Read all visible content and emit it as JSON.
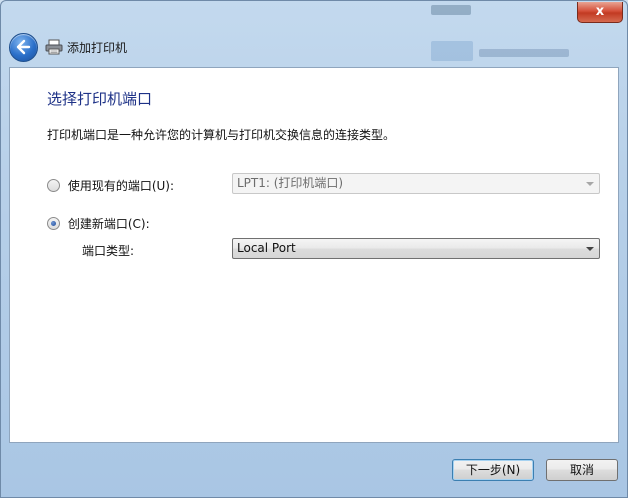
{
  "window": {
    "close_label": "x"
  },
  "nav": {
    "title": "添加打印机"
  },
  "page": {
    "title": "选择打印机端口",
    "description": "打印机端口是一种允许您的计算机与打印机交换信息的连接类型。"
  },
  "options": {
    "use_existing": {
      "label": "使用现有的端口(U):",
      "selected": false,
      "combo_value": "LPT1: (打印机端口)",
      "combo_enabled": false
    },
    "create_new": {
      "label": "创建新端口(C):",
      "selected": true,
      "port_type_label": "端口类型:",
      "combo_value": "Local Port",
      "combo_enabled": true
    }
  },
  "buttons": {
    "next": "下一步(N)",
    "cancel": "取消"
  },
  "colors": {
    "title_blue": "#1e3287",
    "glass": "#b6cfe8",
    "close_red": "#c23a22",
    "default_button_border": "#3c7fb1"
  },
  "icons": {
    "back": "back-arrow-icon",
    "printer": "printer-icon",
    "combo_arrow": "chevron-down-icon"
  }
}
